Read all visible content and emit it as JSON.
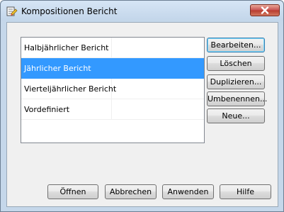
{
  "window": {
    "title": "Kompositionen Bericht"
  },
  "list": {
    "items": [
      {
        "label": "Halbjährlicher Bericht",
        "selected": false
      },
      {
        "label": "Jährlicher Bericht",
        "selected": true
      },
      {
        "label": "Vierteljährlicher Bericht",
        "selected": false
      },
      {
        "label": "Vordefiniert",
        "selected": false
      }
    ]
  },
  "side_buttons": {
    "edit": "Bearbeiten...",
    "delete": "Löschen",
    "duplicate": "Duplizieren...",
    "rename": "Umbenennen...",
    "new": "Neue..."
  },
  "bottom_buttons": {
    "open": "Öffnen",
    "cancel": "Abbrechen",
    "apply": "Anwenden",
    "help": "Hilfe"
  },
  "colors": {
    "selection": "#3399ff",
    "close_button": "#c75050"
  },
  "icons": {
    "app": "report-composition-icon",
    "close": "close-icon"
  }
}
